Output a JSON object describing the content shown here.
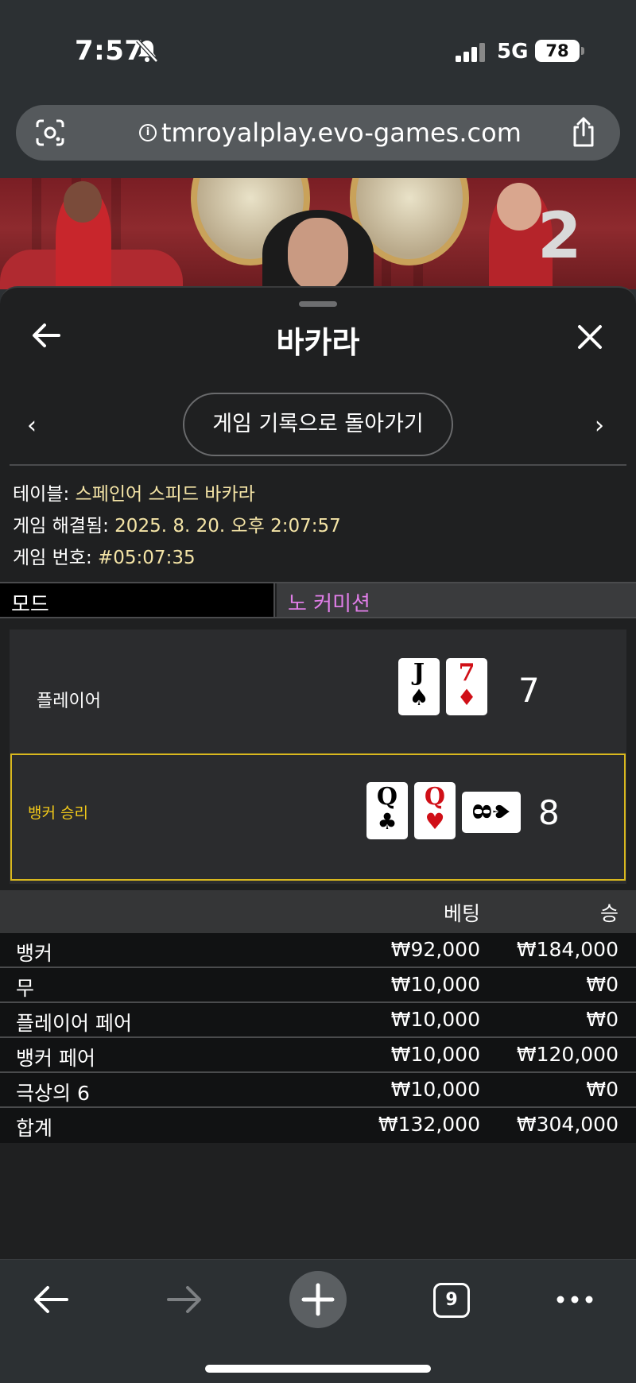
{
  "status_bar": {
    "time": "7:57",
    "network": "5G",
    "battery": "78"
  },
  "browser": {
    "url": "tmroyalplay.evo-games.com",
    "tab_count": "9"
  },
  "video": {
    "round_number": "2"
  },
  "panel": {
    "title": "바카라",
    "history_button": "게임 기록으로 돌아가기",
    "prev_chevron": "‹",
    "next_chevron": "›",
    "table_label": "테이블: ",
    "table_value": "스페인어 스피드 바카라",
    "resolved_label": "게임 해결됨: ",
    "resolved_value": "2025. 8. 20. 오후 2:07:57",
    "game_no_label": "게임 번호: ",
    "game_no_value": "#05:07:35",
    "mode_label": "모드",
    "mode_value": "노 커미션"
  },
  "result": {
    "player": {
      "label": "플레이어",
      "score": "7",
      "cards": [
        {
          "rank": "J",
          "suit": "♠",
          "color": "black"
        },
        {
          "rank": "7",
          "suit": "♦",
          "color": "red"
        }
      ]
    },
    "banker": {
      "label": "뱅커 승리",
      "score": "8",
      "cards": [
        {
          "rank": "Q",
          "suit": "♣",
          "color": "black"
        },
        {
          "rank": "Q",
          "suit": "♥",
          "color": "red"
        },
        {
          "rank": "8",
          "suit": "♠",
          "color": "black",
          "sideways": true
        }
      ]
    }
  },
  "bets": {
    "headers": {
      "bet": "베팅",
      "win": "승"
    },
    "rows": [
      {
        "name": "뱅커",
        "bet": "₩92,000",
        "win": "₩184,000"
      },
      {
        "name": "무",
        "bet": "₩10,000",
        "win": "₩0"
      },
      {
        "name": "플레이어 페어",
        "bet": "₩10,000",
        "win": "₩0"
      },
      {
        "name": "뱅커 페어",
        "bet": "₩10,000",
        "win": "₩120,000"
      },
      {
        "name": "극상의 6",
        "bet": "₩10,000",
        "win": "₩0"
      }
    ],
    "total": {
      "name": "합계",
      "bet": "₩132,000",
      "win": "₩304,000"
    }
  },
  "colors": {
    "accent_gold": "#d9b81e",
    "mode_pink": "#e07ee8",
    "info_value": "#f4e4a6",
    "card_red": "#d00f17"
  }
}
